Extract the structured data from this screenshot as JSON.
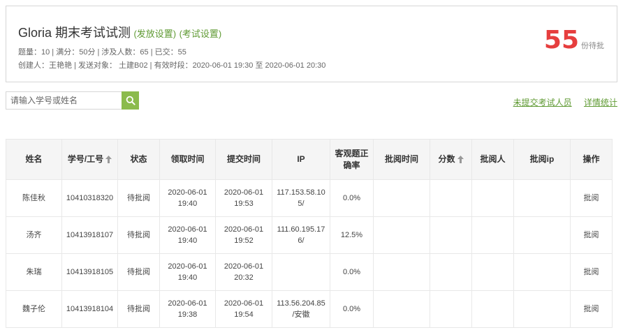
{
  "exam": {
    "title": "Gloria 期末考试试测",
    "publish_settings_link": "(发放设置)",
    "exam_settings_link": "(考试设置)",
    "stats_line": "题量：10 | 满分：50分 | 涉及人数：65 | 已交：55",
    "creator_line": "创建人：王艳艳 | 发送对象：  土建B02  | 有效时段：2020-06-01 19:30 至 2020-06-01 20:30",
    "pending_count": "55",
    "pending_unit": "份待批"
  },
  "search": {
    "placeholder": "请输入学号或姓名",
    "value": "",
    "icon": "search-icon"
  },
  "links": {
    "not_submitted": "未提交考试人员",
    "detail_stats": "详情统计"
  },
  "table": {
    "headers": {
      "name": "姓名",
      "id": "学号/工号",
      "status": "状态",
      "receive_time": "领取时间",
      "submit_time": "提交时间",
      "ip": "IP",
      "objective_rate_1": "客观题正",
      "objective_rate_2": "确率",
      "review_time": "批阅时间",
      "score": "分数",
      "reviewer": "批阅人",
      "review_ip": "批阅ip",
      "operation": "操作"
    },
    "rows": [
      {
        "name": "陈佳秋",
        "id": "10410318320",
        "status": "待批阅",
        "receive_date": "2020-06-01",
        "receive_time": "19:40",
        "submit_date": "2020-06-01",
        "submit_time": "19:53",
        "ip_1": "117.153.58.10",
        "ip_2": "5/",
        "rate": "0.0%",
        "review_time": "",
        "score": "",
        "reviewer": "",
        "review_ip": "",
        "op": "批阅"
      },
      {
        "name": "汤齐",
        "id": "10413918107",
        "status": "待批阅",
        "receive_date": "2020-06-01",
        "receive_time": "19:40",
        "submit_date": "2020-06-01",
        "submit_time": "19:52",
        "ip_1": "111.60.195.17",
        "ip_2": "6/",
        "rate": "12.5%",
        "review_time": "",
        "score": "",
        "reviewer": "",
        "review_ip": "",
        "op": "批阅"
      },
      {
        "name": "朱瑞",
        "id": "10413918105",
        "status": "待批阅",
        "receive_date": "2020-06-01",
        "receive_time": "19:40",
        "submit_date": "2020-06-01",
        "submit_time": "20:32",
        "ip_1": "",
        "ip_2": "",
        "rate": "0.0%",
        "review_time": "",
        "score": "",
        "reviewer": "",
        "review_ip": "",
        "op": "批阅"
      },
      {
        "name": "魏子伦",
        "id": "10413918104",
        "status": "待批阅",
        "receive_date": "2020-06-01",
        "receive_time": "19:38",
        "submit_date": "2020-06-01",
        "submit_time": "19:54",
        "ip_1": "113.56.204.85",
        "ip_2": "/安徽",
        "rate": "0.0%",
        "review_time": "",
        "score": "",
        "reviewer": "",
        "review_ip": "",
        "op": "批阅"
      }
    ]
  },
  "colors": {
    "accent_green": "#5f9a33",
    "button_green": "#8bbb4c",
    "pending_red": "#e63e3e"
  }
}
